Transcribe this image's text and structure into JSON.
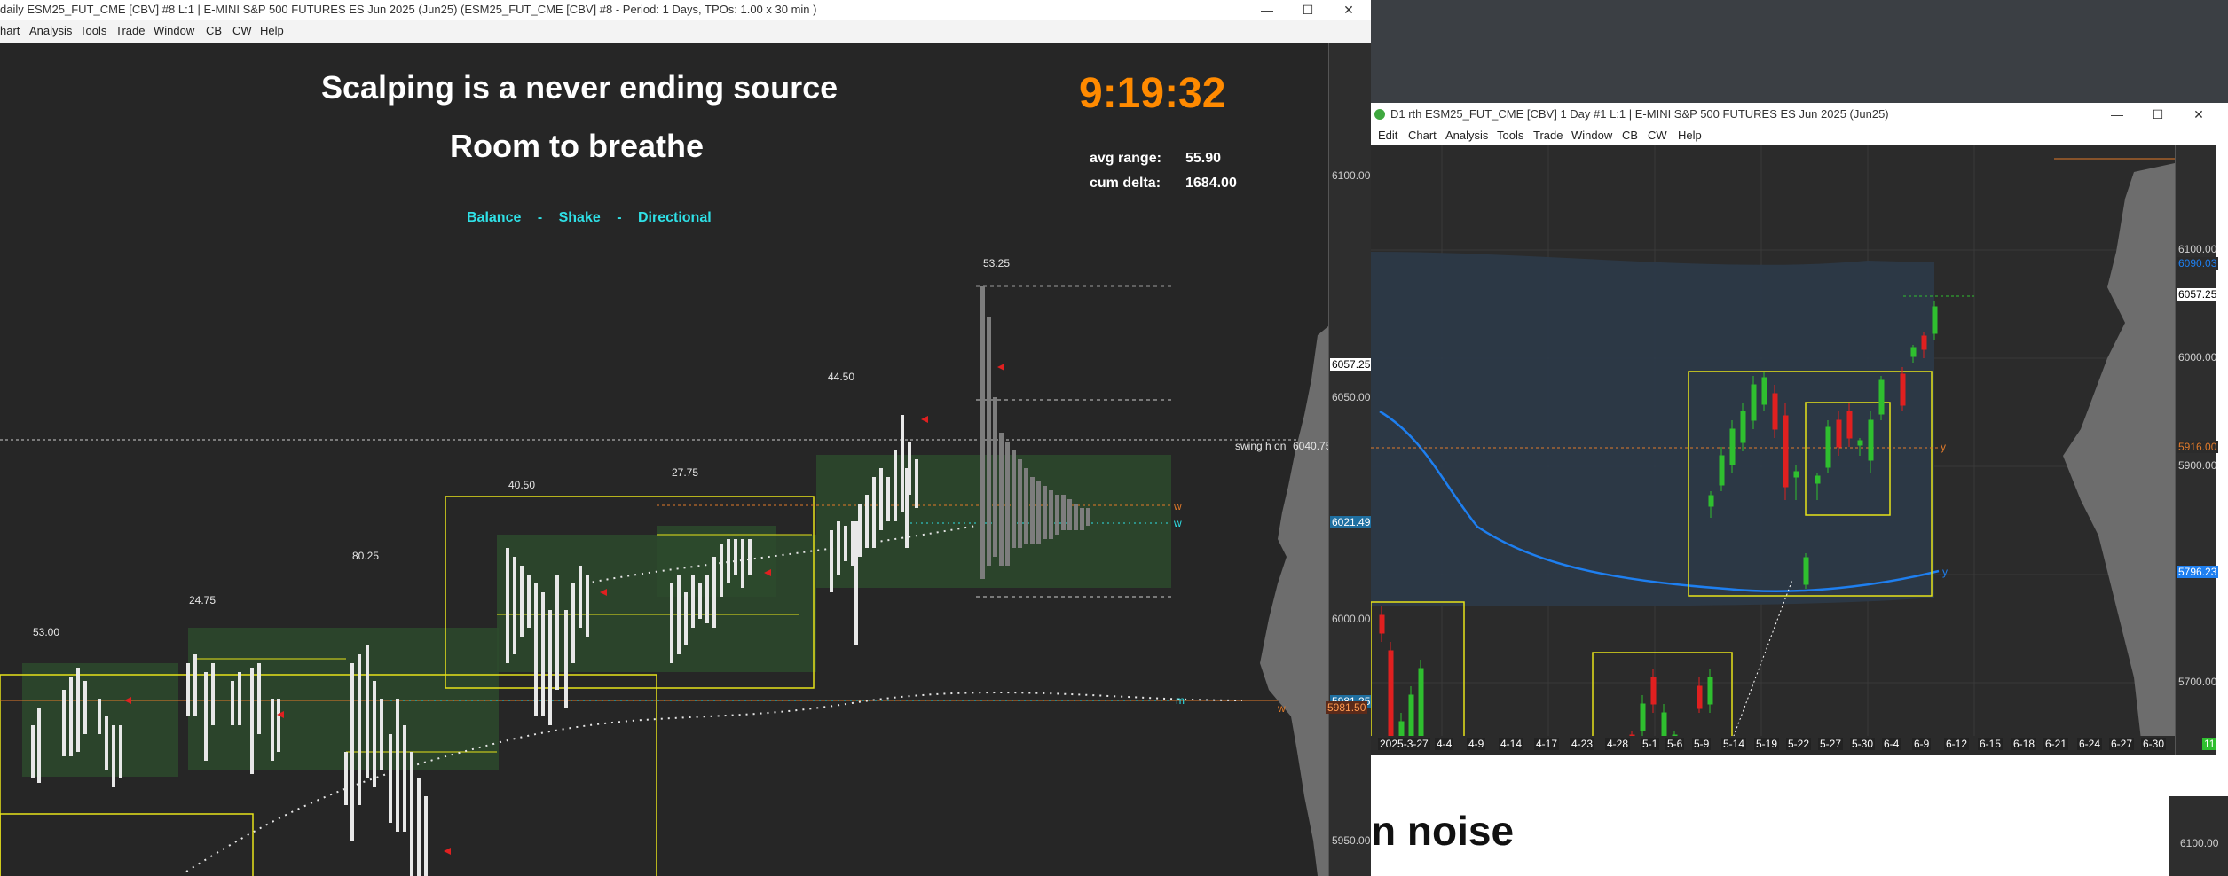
{
  "left_window": {
    "title": "daily ESM25_FUT_CME [CBV] #8 L:1 | E-MINI S&P 500 FUTURES ES Jun 2025 (Jun25)  (ESM25_FUT_CME [CBV] #8 - Period: 1 Days, TPOs: 1.00 x 30 min  )",
    "menu": [
      "hart",
      "Analysis",
      "Tools",
      "Trade",
      "Window",
      "CB",
      "CW",
      "Help"
    ],
    "headline1": "Scalping is a never ending source",
    "headline2": "Room to breathe",
    "subtitle_parts": [
      "Balance",
      "-",
      "Shake",
      "-",
      "Directional"
    ],
    "clock": "9:19:32",
    "stats": {
      "avg_range_label": "avg range:",
      "avg_range_value": "55.90",
      "cum_delta_label": "cum delta:",
      "cum_delta_value": "1684.00"
    },
    "range_labels": [
      "53.00",
      "24.75",
      "80.25",
      "40.50",
      "27.75",
      "44.50",
      "53.25"
    ],
    "swing_label": "swing h on",
    "swing_value": "6040.75",
    "y_ticks": [
      "6100.00",
      "6050.00",
      "6000.00",
      "5950.00"
    ],
    "price_tags": {
      "current": "6057.25",
      "cyan_level": "6021.49",
      "lower": "5981.25",
      "orange": "5981.50"
    },
    "level_letters": [
      "w",
      "w",
      "m",
      "w"
    ]
  },
  "right_window": {
    "title": "D1 rth ESM25_FUT_CME [CBV]  1 Day  #1 L:1 | E-MINI S&P 500 FUTURES ES Jun 2025 (Jun25)",
    "menu": [
      "Edit",
      "Chart",
      "Analysis",
      "Tools",
      "Trade",
      "Window",
      "CB",
      "CW",
      "Help"
    ],
    "y_ticks": [
      "6100.00",
      "6000.00",
      "5900.00",
      "5700.00"
    ],
    "price_tags": {
      "blue": "6090.03",
      "current": "6057.25",
      "orange": "5916.00",
      "low_blue": "5796.23"
    },
    "x_ticks": [
      "2025-3-27",
      "4-4",
      "4-9",
      "4-14",
      "4-17",
      "4-23",
      "4-28",
      "5-1",
      "5-6",
      "5-9",
      "5-14",
      "5-19",
      "5-22",
      "5-27",
      "5-30",
      "6-4",
      "6-9",
      "6-12",
      "6-15",
      "6-18",
      "6-21",
      "6-24",
      "6-27",
      "6-30"
    ],
    "corner_badge": "11",
    "level_letters": [
      "y",
      "y"
    ],
    "bottom_text": "n noise",
    "bottom_tick": "6100.00"
  },
  "colors": {
    "accent_orange": "#ff8a00",
    "cyan": "#2fe0e6",
    "box_yellow": "#e6e21a",
    "balance_green": "#2f4a2f",
    "vwap_blue": "#1e7ff0"
  }
}
